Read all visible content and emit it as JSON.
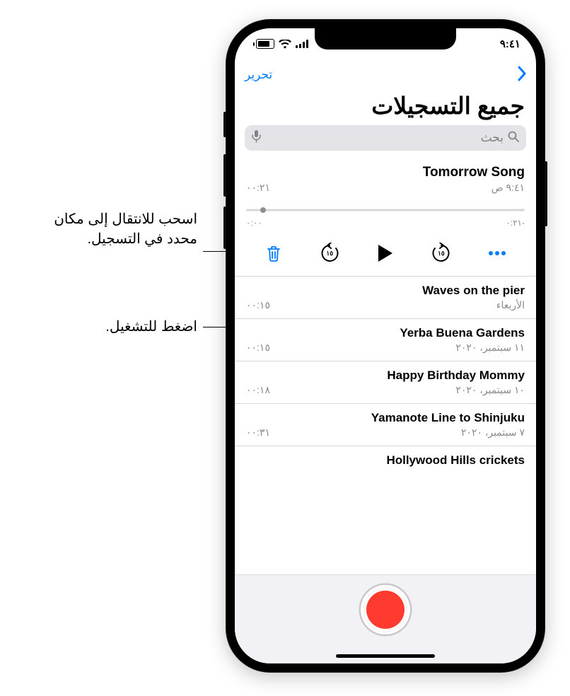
{
  "status": {
    "time": "٩:٤١"
  },
  "nav": {
    "edit": "تحرير"
  },
  "title": "جميع التسجيلات",
  "search": {
    "placeholder": "بحث"
  },
  "expanded": {
    "title": "Tomorrow Song",
    "subtitle": "٩:٤١ ص",
    "duration": "٠٠:٢١",
    "pos_start": "٠:٠٠",
    "pos_end": "-٠:٢١",
    "skip_num": "١٥"
  },
  "rows": [
    {
      "title": "Waves on the pier",
      "subtitle": "الأربعاء",
      "duration": "٠٠:١٥"
    },
    {
      "title": "Yerba Buena Gardens",
      "subtitle": "١١ سبتمبر، ٢٠٢٠",
      "duration": "٠٠:١٥"
    },
    {
      "title": "Happy Birthday Mommy",
      "subtitle": "١٠ سبتمبر، ٢٠٢٠",
      "duration": "٠٠:١٨"
    },
    {
      "title": "Yamanote Line to Shinjuku",
      "subtitle": "٧ سبتمبر، ٢٠٢٠",
      "duration": "٠٠:٣١"
    },
    {
      "title": "Hollywood Hills crickets",
      "subtitle": "",
      "duration": ""
    }
  ],
  "callouts": {
    "c1a": "اسحب للانتقال إلى مكان",
    "c1b": "محدد في التسجيل.",
    "c2": "اضغط للتشغيل."
  }
}
